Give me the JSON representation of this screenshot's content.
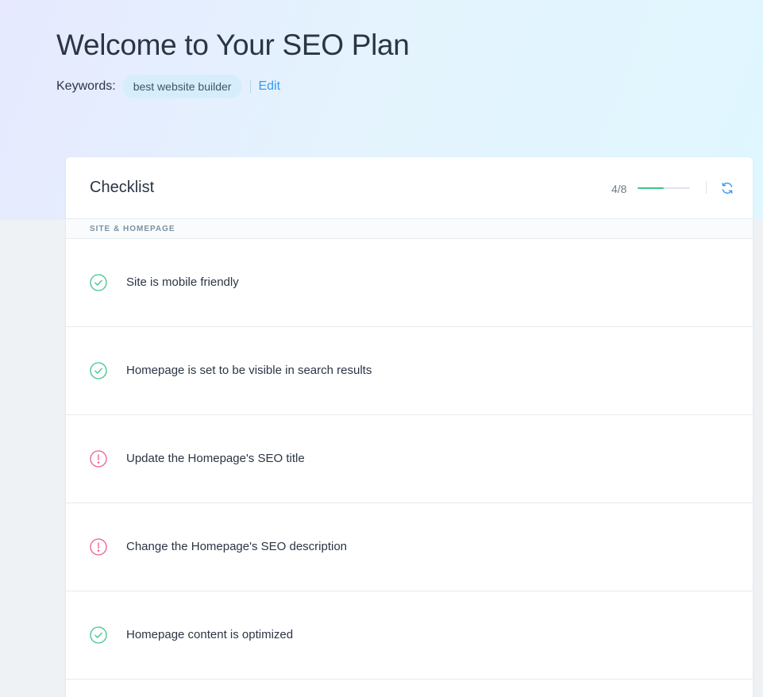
{
  "header": {
    "title": "Welcome to Your SEO Plan",
    "keywords_label": "Keywords:",
    "keyword": "best website builder",
    "edit_label": "Edit"
  },
  "checklist": {
    "title": "Checklist",
    "progress_text": "4/8",
    "progress_fraction": 0.5,
    "accent_color": "#3ec38a",
    "refresh_icon": "refresh-icon",
    "section_label": "SITE & HOMEPAGE",
    "items": [
      {
        "label": "Site is mobile friendly",
        "status": "done",
        "icon": "check-circle-icon"
      },
      {
        "label": "Homepage is set to be visible in search results",
        "status": "done",
        "icon": "check-circle-icon"
      },
      {
        "label": "Update the Homepage's SEO title",
        "status": "todo",
        "icon": "alert-circle-icon"
      },
      {
        "label": "Change the Homepage's SEO description",
        "status": "todo",
        "icon": "alert-circle-icon"
      },
      {
        "label": "Homepage content is optimized",
        "status": "done",
        "icon": "check-circle-icon"
      }
    ]
  },
  "colors": {
    "done": "#3ec38a",
    "todo": "#ee5c8a",
    "link": "#3899ec"
  }
}
